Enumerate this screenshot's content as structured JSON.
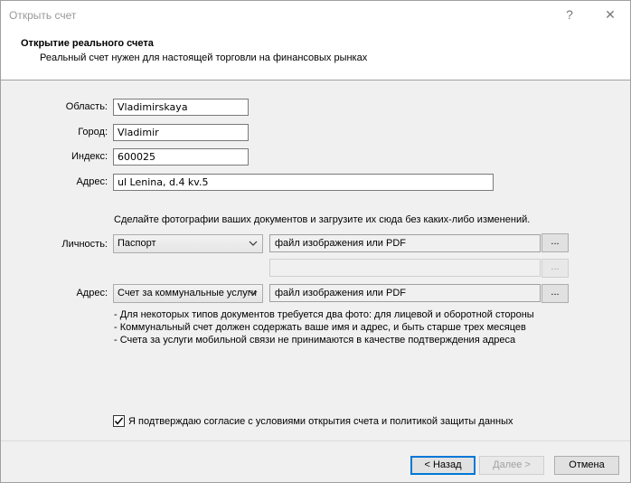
{
  "window": {
    "title": "Открыть счет",
    "help_label": "?",
    "close_label": "✕"
  },
  "header": {
    "title": "Открытие реального счета",
    "subtitle": "Реальный счет нужен для настоящей торговли на финансовых рынках"
  },
  "form": {
    "region_label": "Область:",
    "region_value": "Vladimirskaya",
    "city_label": "Город:",
    "city_value": "Vladimir",
    "index_label": "Индекс:",
    "index_value": "600025",
    "address_label": "Адрес:",
    "address_value": "ul Lenina, d.4 kv.5"
  },
  "documents": {
    "instruction": "Сделайте фотографии ваших документов и загрузите их сюда без каких-либо изменений.",
    "identity_label": "Личность:",
    "identity_type": "Паспорт",
    "identity_file": "файл изображения или PDF",
    "identity_file2": "",
    "address_label": "Адрес:",
    "address_type": "Счет за коммунальные услуги",
    "address_file": "файл изображения или PDF",
    "browse_label": "...",
    "notes": [
      "- Для некоторых типов документов требуется два фото: для лицевой и оборотной стороны",
      "- Коммунальный счет должен содержать ваше имя и адрес, и быть старше трех месяцев",
      "- Счета за услуги мобильной связи не принимаются в качестве подтверждения адреса"
    ]
  },
  "consent": {
    "checked": true,
    "label": "Я подтверждаю согласие с условиями открытия счета и политикой защиты данных"
  },
  "footer": {
    "back_label": "< Назад",
    "next_label": "Далее >",
    "cancel_label": "Отмена"
  },
  "colors": {
    "primary_button_border": "#0078d7",
    "window_border": "#a0a0a0"
  }
}
